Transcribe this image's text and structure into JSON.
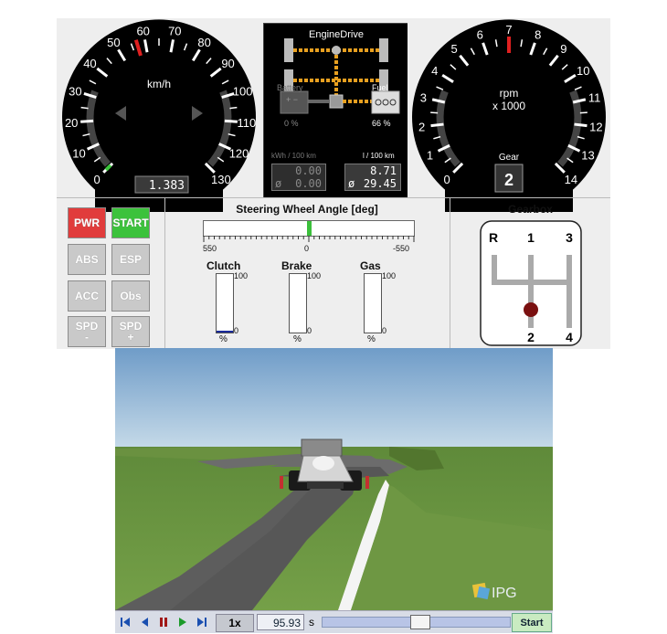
{
  "speedometer": {
    "unit": "km/h",
    "ticks": [
      "0",
      "10",
      "20",
      "30",
      "40",
      "50",
      "60",
      "70",
      "80",
      "90",
      "100",
      "110",
      "120",
      "130"
    ],
    "value_kmh": 57,
    "odometer": "1.383"
  },
  "tachometer": {
    "unit": "rpm",
    "multiplier": "x 1000",
    "ticks": [
      "0",
      "1",
      "2",
      "3",
      "4",
      "5",
      "6",
      "7",
      "8",
      "9",
      "10",
      "11",
      "12",
      "13",
      "14"
    ],
    "value_krpm": 7,
    "gear_label": "Gear",
    "gear": "2"
  },
  "engine_drive": {
    "title": "EngineDrive",
    "battery_label": "Battery",
    "battery_pct": "0 %",
    "fuel_label": "Fuel",
    "fuel_pct": "66 %",
    "kwh_label": "kWh / 100 km",
    "l_label": "l / 100 km",
    "kwh_current": "0.00",
    "kwh_avg": "0.00",
    "l_current": "8.71",
    "l_avg": "29.45",
    "avg_symbol": "ø"
  },
  "buttons": {
    "pwr": "PWR",
    "start": "START",
    "abs": "ABS",
    "esp": "ESP",
    "acc": "ACC",
    "obs": "Obs",
    "spd_minus_top": "SPD",
    "spd_minus_bottom": "-",
    "spd_plus_top": "SPD",
    "spd_plus_bottom": "+"
  },
  "steering": {
    "title": "Steering Wheel Angle [deg]",
    "left": "550",
    "center": "0",
    "right": "-550",
    "value_deg": 0
  },
  "pedals": {
    "clutch": {
      "label": "Clutch",
      "max": "100",
      "min": "0",
      "unit": "%",
      "value_pct": 3
    },
    "brake": {
      "label": "Brake",
      "max": "100",
      "min": "0",
      "unit": "%",
      "value_pct": 0
    },
    "gas": {
      "label": "Gas",
      "max": "100",
      "min": "0",
      "unit": "%",
      "value_pct": 0
    }
  },
  "gearbox": {
    "title": "Gearbox",
    "r": "R",
    "g1": "1",
    "g3": "3",
    "g2": "2",
    "g4": "4",
    "selected": "2"
  },
  "viewport": {
    "logo": "IPG"
  },
  "controls": {
    "speed": "1x",
    "time": "95.93",
    "time_unit": "s",
    "start_label": "Start",
    "colors": {
      "accent": "#1a4fb0",
      "play": "#1b9a2a",
      "stop": "#a01818"
    }
  }
}
